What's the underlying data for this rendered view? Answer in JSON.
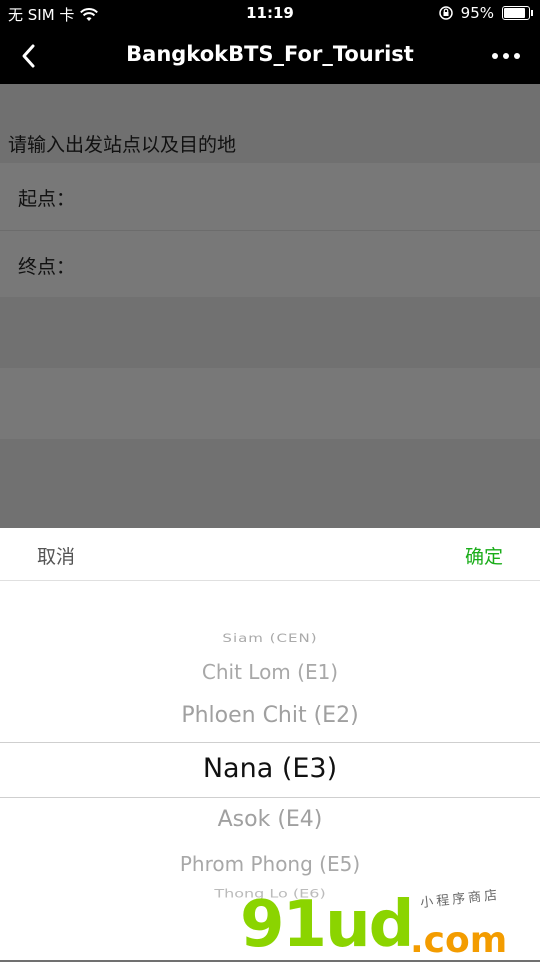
{
  "status_bar": {
    "carrier": "无 SIM 卡",
    "time": "11:19",
    "battery_percent": "95%",
    "battery_level": 0.95,
    "icons": [
      "wifi-icon",
      "orientation-lock-icon",
      "battery-icon"
    ]
  },
  "nav": {
    "title": "BangkokBTS_For_Tourist",
    "back_icon": "chevron-left-icon",
    "more_icon": "more-dots-icon"
  },
  "form": {
    "prompt": "请输入出发站点以及目的地",
    "start_label": "起点：",
    "end_label": "终点："
  },
  "picker": {
    "cancel": "取消",
    "confirm": "确定",
    "confirm_color": "#1aad19",
    "options": [
      "Siam (CEN)",
      "Chit Lom (E1)",
      "Phloen Chit (E2)",
      "Nana (E3)",
      "Asok (E4)",
      "Phrom Phong (E5)",
      "Thong Lo (E6)"
    ],
    "selected": "Nana (E3)"
  },
  "watermark": {
    "brand": "91ud",
    "domain": ".com",
    "tagline": "小程序商店"
  }
}
